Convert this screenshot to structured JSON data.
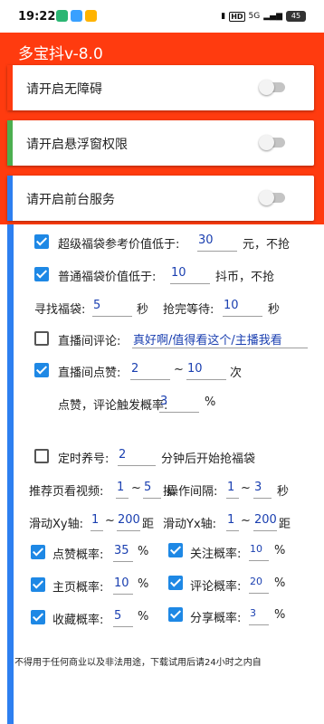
{
  "status_bar": {
    "time": "19:22",
    "network": "HD",
    "signal": "5G",
    "battery": "45"
  },
  "app": {
    "title": "多宝抖v-8.0"
  },
  "permissions": [
    {
      "label": "请开启无障碍",
      "enabled": false,
      "color": "#ff3b0f"
    },
    {
      "label": "请开启悬浮窗权限",
      "enabled": false,
      "color": "#4caf50"
    },
    {
      "label": "请开启前台服务",
      "enabled": false,
      "color": "#2d7ff0"
    }
  ],
  "settings": {
    "super_bag": {
      "checked": true,
      "label": "超级福袋参考价值低于:",
      "value": "30",
      "suffix": "元，不抢"
    },
    "normal_bag": {
      "checked": true,
      "label": "普通福袋价值低于:",
      "value": "10",
      "suffix": "抖币，不抢"
    },
    "find_bag": {
      "label": "寻找福袋:",
      "value": "5",
      "unit": "秒"
    },
    "wait_after": {
      "label": "抢完等待:",
      "value": "10",
      "unit": "秒"
    },
    "comment": {
      "checked": false,
      "label": "直播间评论:",
      "value": "真好啊/值得看这个/主播我看"
    },
    "like": {
      "checked": true,
      "label": "直播间点赞:",
      "min": "2",
      "sep": "~",
      "max": "10",
      "unit": "次"
    },
    "trigger": {
      "label": "点赞，评论触发概率:",
      "value": "3",
      "unit": "%"
    },
    "schedule": {
      "checked": false,
      "label": "定时养号:",
      "value": "2",
      "suffix": "分钟后开始抢福袋"
    },
    "recommend": {
      "label": "推荐页看视频:",
      "min": "1",
      "sep": "~",
      "max": "5",
      "unit": "操"
    },
    "interval": {
      "label": "操作间隔:",
      "min": "1",
      "sep": "~",
      "max": "3",
      "unit": "秒"
    },
    "slide_xy": {
      "label": "滑动Xy轴:",
      "min": "1",
      "sep": "~",
      "max": "200",
      "unit": "距"
    },
    "slide_yx": {
      "label": "滑动Yx轴:",
      "min": "1",
      "sep": "~",
      "max": "200",
      "unit": "距"
    },
    "probs": [
      {
        "checked": true,
        "label": "点赞概率:",
        "value": "35",
        "unit": "%"
      },
      {
        "checked": true,
        "label": "关注概率:",
        "value": "10",
        "unit": "%"
      },
      {
        "checked": true,
        "label": "主页概率:",
        "value": "10",
        "unit": "%"
      },
      {
        "checked": true,
        "label": "评论概率:",
        "value": "20",
        "unit": "%"
      },
      {
        "checked": true,
        "label": "收藏概率:",
        "value": "5",
        "unit": "%"
      },
      {
        "checked": true,
        "label": "分享概率:",
        "value": "3",
        "unit": "%"
      }
    ]
  },
  "notice": "不得用于任何商业以及非法用途，下载试用后请24小时之内自"
}
